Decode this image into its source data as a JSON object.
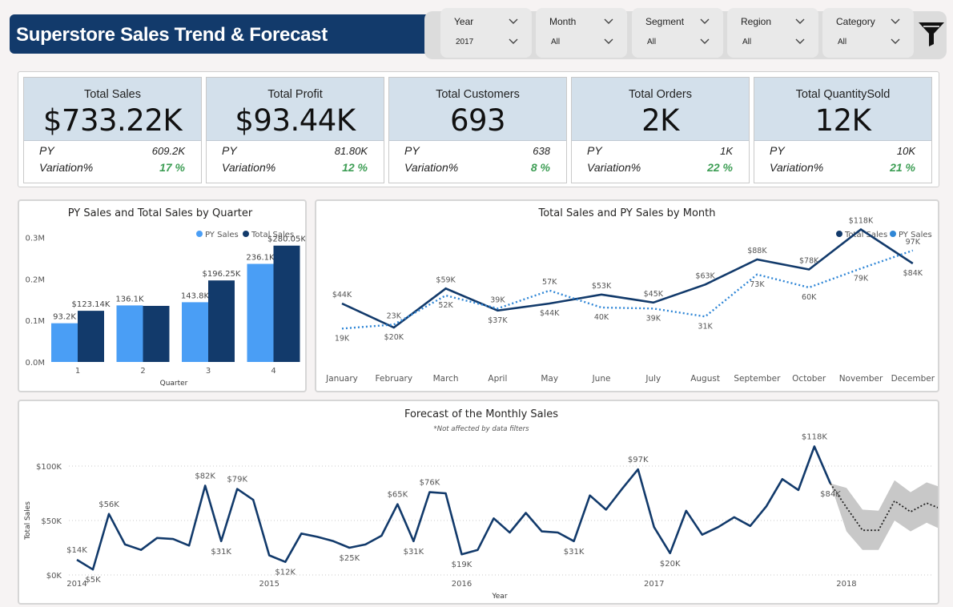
{
  "header": {
    "title": "Superstore Sales Trend & Forecast"
  },
  "filters": [
    {
      "label": "Year",
      "value": "2017"
    },
    {
      "label": "Month",
      "value": "All"
    },
    {
      "label": "Segment",
      "value": "All"
    },
    {
      "label": "Region",
      "value": "All"
    },
    {
      "label": "Category",
      "value": "All"
    }
  ],
  "kpis": [
    {
      "title": "Total Sales",
      "value": "$733.22K",
      "py_label": "PY",
      "py": "609.2K",
      "var_label": "Variation%",
      "variation": "17 %"
    },
    {
      "title": "Total Profit",
      "value": "$93.44K",
      "py_label": "PY",
      "py": "81.80K",
      "var_label": "Variation%",
      "variation": "12 %"
    },
    {
      "title": "Total Customers",
      "value": "693",
      "py_label": "PY",
      "py": "638",
      "var_label": "Variation%",
      "variation": "8 %"
    },
    {
      "title": "Total Orders",
      "value": "2K",
      "py_label": "PY",
      "py": "1K",
      "var_label": "Variation%",
      "variation": "22 %"
    },
    {
      "title": "Total QuantitySold",
      "value": "12K",
      "py_label": "PY",
      "py": "10K",
      "var_label": "Variation%",
      "variation": "21 %"
    }
  ],
  "colors": {
    "total_sales": "#123a6b",
    "py_sales_bar": "#4a9ef5",
    "py_sales_line": "#2f86d6",
    "positive": "#3e9e55",
    "forecast_band": "#c8c8c8"
  },
  "chart_data": [
    {
      "type": "bar",
      "title": "PY Sales and Total Sales by Quarter",
      "xlabel": "Quarter",
      "ylabel": "",
      "categories": [
        "1",
        "2",
        "3",
        "4"
      ],
      "y_ticks": [
        "0.0M",
        "0.1M",
        "0.2M",
        "0.3M"
      ],
      "ylim": [
        0,
        0.32
      ],
      "legend_position": "top-right",
      "series": [
        {
          "name": "PY Sales",
          "values": [
            0.0932,
            0.1361,
            0.1438,
            0.2361
          ],
          "labels": [
            "93.2K",
            "136.1K",
            "143.8K",
            "236.1K"
          ]
        },
        {
          "name": "Total Sales",
          "values": [
            0.12314,
            0.135,
            0.19625,
            0.28005
          ],
          "labels": [
            "$123.14K",
            "",
            "$196.25K",
            "$280.05K"
          ]
        }
      ]
    },
    {
      "type": "line",
      "title": "Total Sales and PY Sales by Month",
      "categories": [
        "January",
        "February",
        "March",
        "April",
        "May",
        "June",
        "July",
        "August",
        "September",
        "October",
        "November",
        "December"
      ],
      "legend_position": "top-right",
      "series": [
        {
          "name": "Total Sales",
          "style": "solid",
          "values": [
            44,
            20,
            59,
            37,
            44,
            53,
            45,
            63,
            88,
            78,
            118,
            84
          ],
          "labels": [
            "$44K",
            "$20K",
            "$59K",
            "$37K",
            "$44K",
            "$53K",
            "$45K",
            "$63K",
            "$88K",
            "$78K",
            "$118K",
            "$84K"
          ]
        },
        {
          "name": "PY Sales",
          "style": "dotted",
          "values": [
            19,
            23,
            52,
            39,
            57,
            40,
            39,
            31,
            73,
            60,
            79,
            97
          ],
          "labels": [
            "19K",
            "23K",
            "52K",
            "39K",
            "57K",
            "40K",
            "39K",
            "31K",
            "73K",
            "60K",
            "79K",
            "97K"
          ]
        }
      ]
    },
    {
      "type": "line",
      "title": "Forecast of the Monthly Sales",
      "subtitle": "*Not affected by data filters",
      "xlabel": "Year",
      "ylabel": "Total Sales",
      "x_ticks": [
        "2014",
        "2015",
        "2016",
        "2017",
        "2018"
      ],
      "y_ticks": [
        "$0K",
        "$50K",
        "$100K"
      ],
      "ylim": [
        0,
        120
      ],
      "series": [
        {
          "name": "Total Sales",
          "style": "solid",
          "values": [
            14,
            5,
            56,
            28,
            23,
            34,
            33,
            27,
            82,
            31,
            79,
            69,
            18,
            12,
            38,
            35,
            31,
            25,
            28,
            36,
            65,
            31,
            76,
            75,
            19,
            23,
            52,
            39,
            57,
            40,
            39,
            31,
            73,
            60,
            79,
            97,
            44,
            20,
            59,
            37,
            44,
            53,
            45,
            63,
            88,
            78,
            118,
            84
          ],
          "labels": {
            "0": "$14K",
            "1": "$5K",
            "2": "$56K",
            "8": "$82K",
            "9": "$31K",
            "10": "$79K",
            "13": "$12K",
            "17": "$25K",
            "20": "$65K",
            "21": "$31K",
            "22": "$76K",
            "24": "$19K",
            "31": "$31K",
            "35": "$97K",
            "37": "$20K",
            "46": "$118K",
            "47": "$84K"
          }
        },
        {
          "name": "Forecast",
          "style": "dotted",
          "values": [
            84,
            62,
            41,
            41,
            68,
            58,
            66,
            60
          ],
          "lower": [
            84,
            40,
            23,
            23,
            50,
            40,
            48,
            41
          ],
          "upper": [
            84,
            80,
            60,
            59,
            87,
            76,
            85,
            80
          ]
        }
      ]
    }
  ]
}
